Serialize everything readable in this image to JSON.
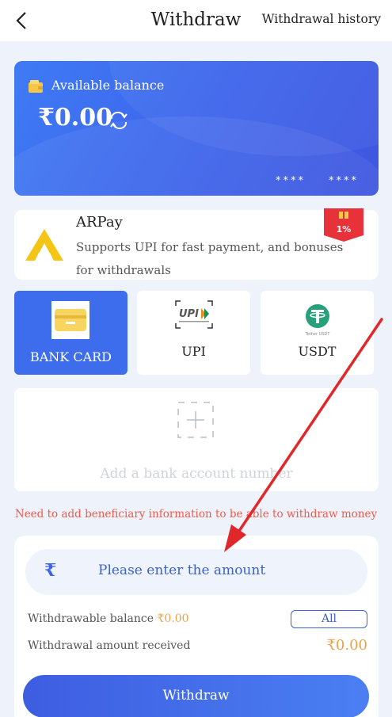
{
  "header": {
    "title": "Withdraw",
    "history_label": "Withdrawal history"
  },
  "balance_card": {
    "label": "Available balance",
    "amount": "₹0.00",
    "card_mask_1": "****",
    "card_mask_2": "****"
  },
  "arpay": {
    "name": "ARPay",
    "description": "Supports UPI for fast payment, and bonuses for withdrawals",
    "bonus_badge": "1%"
  },
  "methods": [
    {
      "label": "BANK CARD",
      "icon": "bank-card-icon",
      "active": true
    },
    {
      "label": "UPI",
      "icon": "upi-logo-icon",
      "active": false
    },
    {
      "label": "USDT",
      "icon": "tether-icon",
      "active": false
    }
  ],
  "add_account": {
    "text": "Add a bank account number"
  },
  "warning": "Need to add beneficiary information to be able to withdraw money",
  "amount_panel": {
    "currency_symbol": "₹",
    "placeholder": "Please enter the amount",
    "withdrawable_label": "Withdrawable balance",
    "withdrawable_value": "₹0.00",
    "all_label": "All",
    "received_label": "Withdrawal amount received",
    "received_value": "₹0.00"
  },
  "withdraw_button": "Withdraw",
  "colors": {
    "primary": "#3d6cec",
    "accent_orange": "#e8a34a",
    "warning_red": "#f25a4a",
    "annotation_arrow": "#e0282a"
  }
}
